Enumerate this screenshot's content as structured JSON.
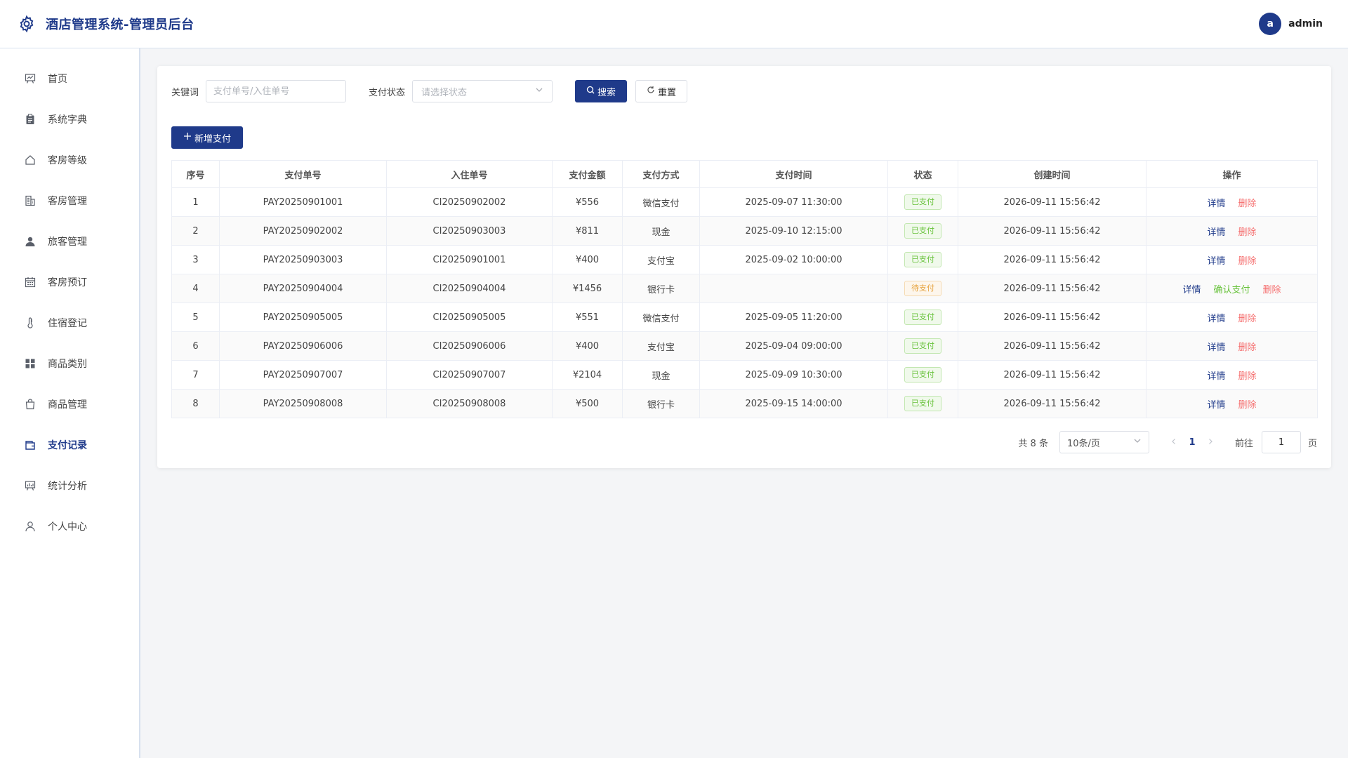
{
  "header": {
    "title": "酒店管理系统-管理员后台",
    "avatar_letter": "a",
    "username": "admin"
  },
  "sidebar": {
    "items": [
      {
        "label": "首页",
        "icon": "chart-board-icon"
      },
      {
        "label": "系统字典",
        "icon": "clipboard-icon"
      },
      {
        "label": "客房等级",
        "icon": "home-icon"
      },
      {
        "label": "客房管理",
        "icon": "building-icon"
      },
      {
        "label": "旅客管理",
        "icon": "user-filled-icon"
      },
      {
        "label": "客房预订",
        "icon": "calendar-icon"
      },
      {
        "label": "住宿登记",
        "icon": "thermometer-icon"
      },
      {
        "label": "商品类别",
        "icon": "grid-icon"
      },
      {
        "label": "商品管理",
        "icon": "shopping-bag-icon"
      },
      {
        "label": "支付记录",
        "icon": "wallet-icon",
        "active": true
      },
      {
        "label": "统计分析",
        "icon": "data-board-icon"
      },
      {
        "label": "个人中心",
        "icon": "user-outline-icon"
      }
    ]
  },
  "filters": {
    "keyword_label": "关键词",
    "keyword_placeholder": "支付单号/入住单号",
    "status_label": "支付状态",
    "status_placeholder": "请选择状态",
    "search_label": "搜索",
    "reset_label": "重置"
  },
  "actions": {
    "add_label": "新增支付"
  },
  "table": {
    "headers": [
      "序号",
      "支付单号",
      "入住单号",
      "支付金额",
      "支付方式",
      "支付时间",
      "状态",
      "创建时间",
      "操作"
    ],
    "rows": [
      {
        "index": "1",
        "pay_no": "PAY20250901001",
        "checkin_no": "CI20250902002",
        "amount": "¥556",
        "method": "微信支付",
        "pay_time": "2025-09-07 11:30:00",
        "status": "已支付",
        "status_type": "paid",
        "created": "2026-09-11 15:56:42"
      },
      {
        "index": "2",
        "pay_no": "PAY20250902002",
        "checkin_no": "CI20250903003",
        "amount": "¥811",
        "method": "现金",
        "pay_time": "2025-09-10 12:15:00",
        "status": "已支付",
        "status_type": "paid",
        "created": "2026-09-11 15:56:42"
      },
      {
        "index": "3",
        "pay_no": "PAY20250903003",
        "checkin_no": "CI20250901001",
        "amount": "¥400",
        "method": "支付宝",
        "pay_time": "2025-09-02 10:00:00",
        "status": "已支付",
        "status_type": "paid",
        "created": "2026-09-11 15:56:42"
      },
      {
        "index": "4",
        "pay_no": "PAY20250904004",
        "checkin_no": "CI20250904004",
        "amount": "¥1456",
        "method": "银行卡",
        "pay_time": "",
        "status": "待支付",
        "status_type": "pending",
        "created": "2026-09-11 15:56:42"
      },
      {
        "index": "5",
        "pay_no": "PAY20250905005",
        "checkin_no": "CI20250905005",
        "amount": "¥551",
        "method": "微信支付",
        "pay_time": "2025-09-05 11:20:00",
        "status": "已支付",
        "status_type": "paid",
        "created": "2026-09-11 15:56:42"
      },
      {
        "index": "6",
        "pay_no": "PAY20250906006",
        "checkin_no": "CI20250906006",
        "amount": "¥400",
        "method": "支付宝",
        "pay_time": "2025-09-04 09:00:00",
        "status": "已支付",
        "status_type": "paid",
        "created": "2026-09-11 15:56:42"
      },
      {
        "index": "7",
        "pay_no": "PAY20250907007",
        "checkin_no": "CI20250907007",
        "amount": "¥2104",
        "method": "现金",
        "pay_time": "2025-09-09 10:30:00",
        "status": "已支付",
        "status_type": "paid",
        "created": "2026-09-11 15:56:42"
      },
      {
        "index": "8",
        "pay_no": "PAY20250908008",
        "checkin_no": "CI20250908008",
        "amount": "¥500",
        "method": "银行卡",
        "pay_time": "2025-09-15 14:00:00",
        "status": "已支付",
        "status_type": "paid",
        "created": "2026-09-11 15:56:42"
      }
    ],
    "op_detail": "详情",
    "op_confirm": "确认支付",
    "op_delete": "删除"
  },
  "pagination": {
    "total_text": "共 8 条",
    "page_size": "10条/页",
    "current_page": "1",
    "goto_label": "前往",
    "goto_value": "1",
    "page_suffix": "页"
  },
  "colors": {
    "primary": "#1f3a8a",
    "success": "#67c23a",
    "warning": "#e6a23c",
    "danger": "#f56c6c"
  }
}
